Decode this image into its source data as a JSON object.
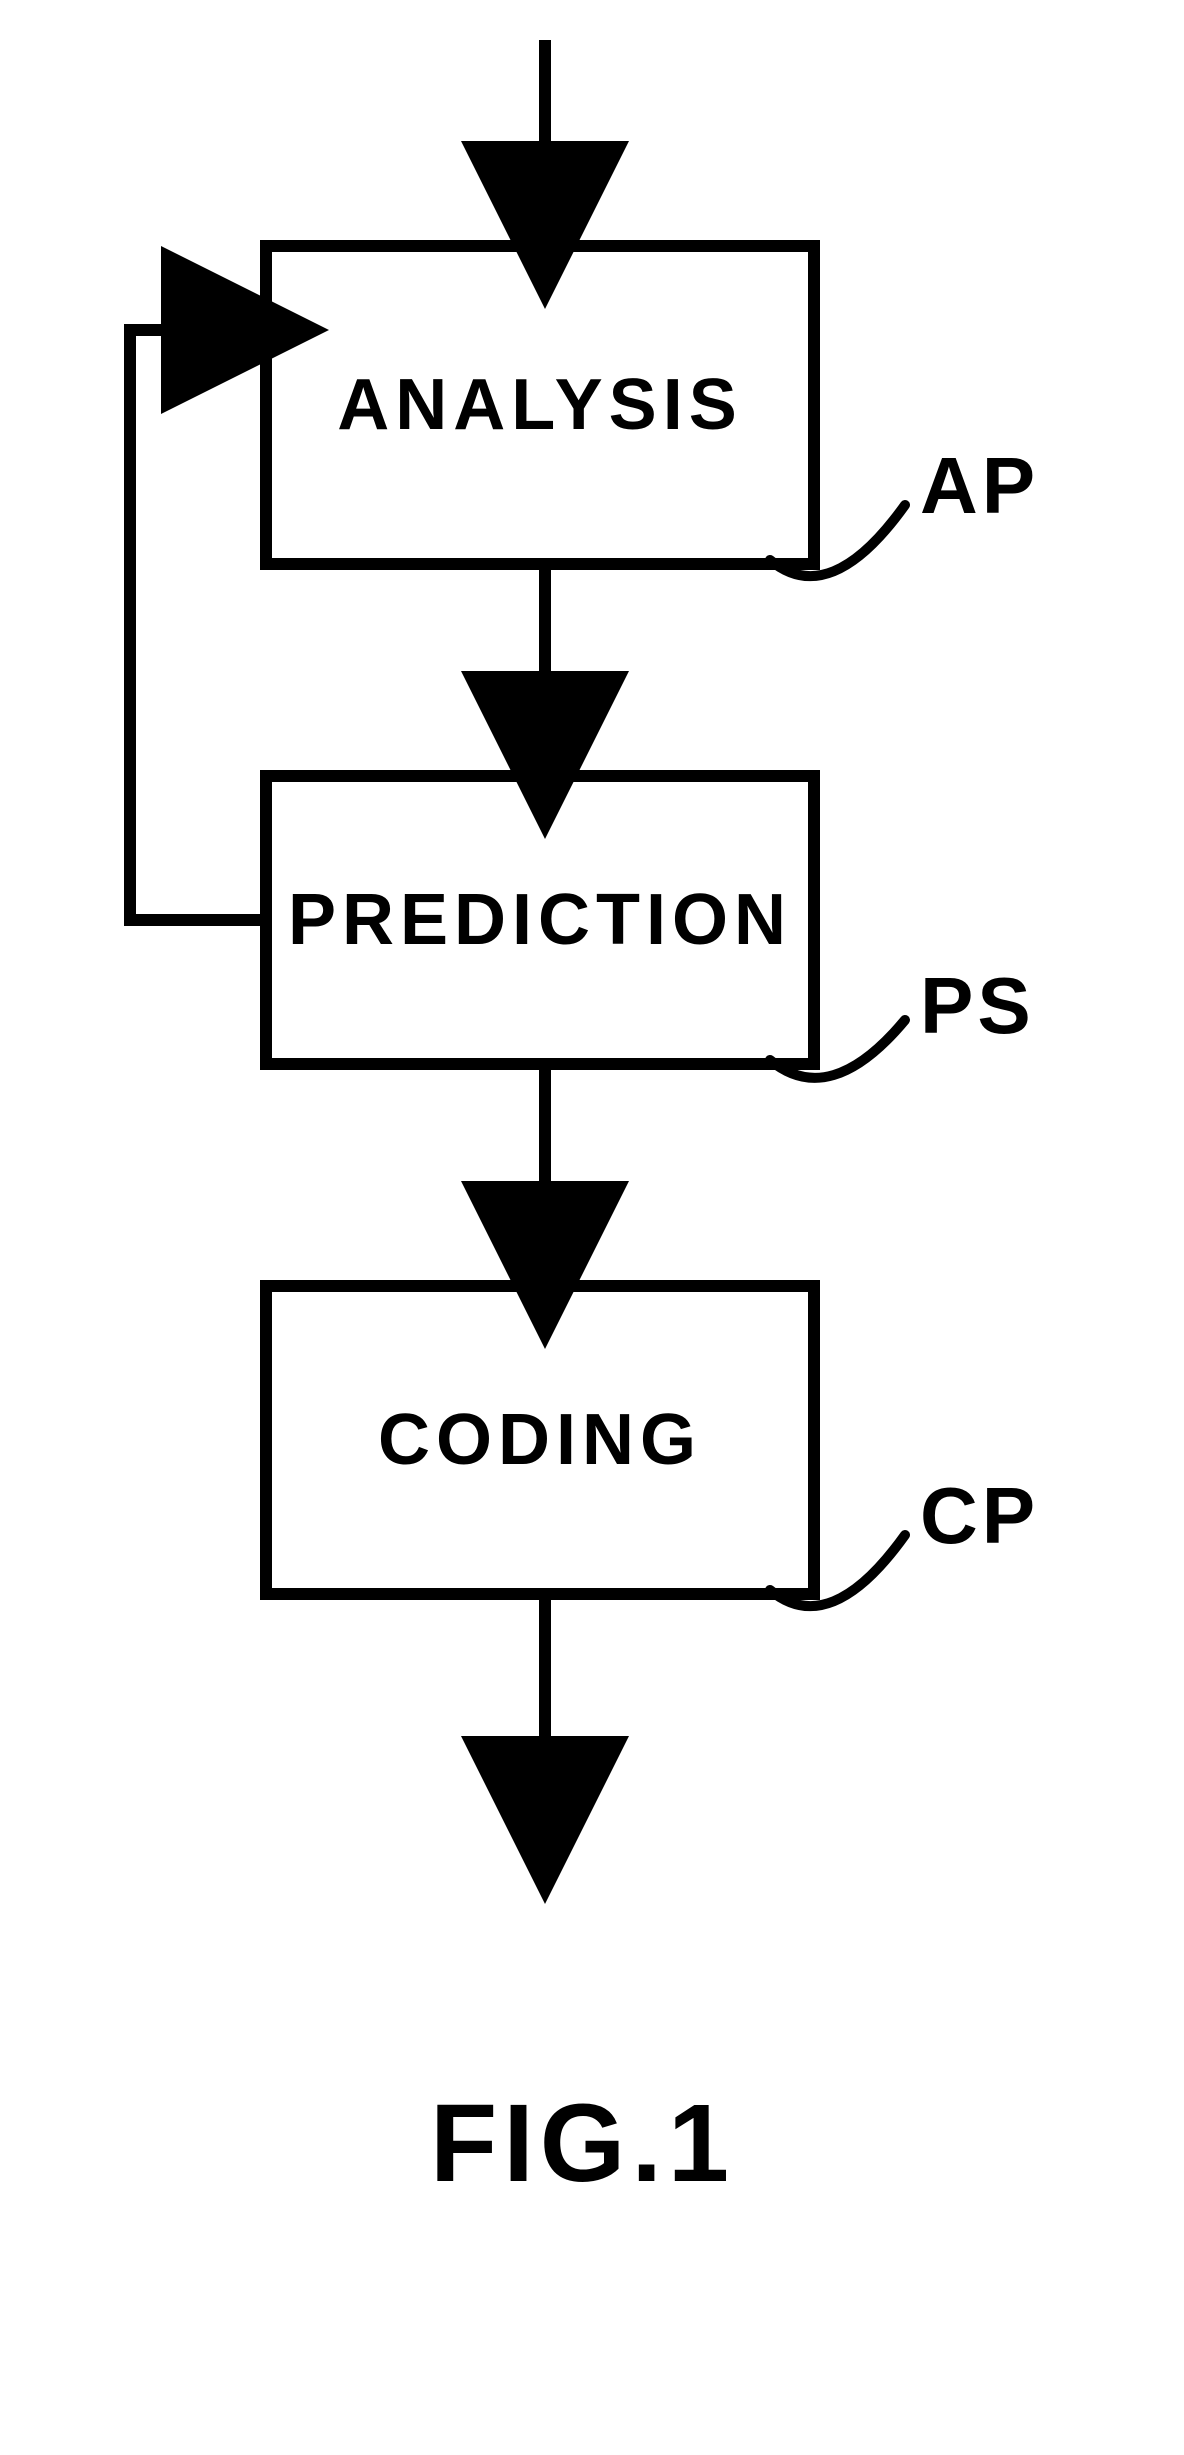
{
  "diagram": {
    "blocks": {
      "analysis": {
        "label": "ANALYSIS",
        "tag": "AP"
      },
      "prediction": {
        "label": "PREDICTION",
        "tag": "PS"
      },
      "coding": {
        "label": "CODING",
        "tag": "CP"
      }
    },
    "caption": "FIG.1"
  }
}
